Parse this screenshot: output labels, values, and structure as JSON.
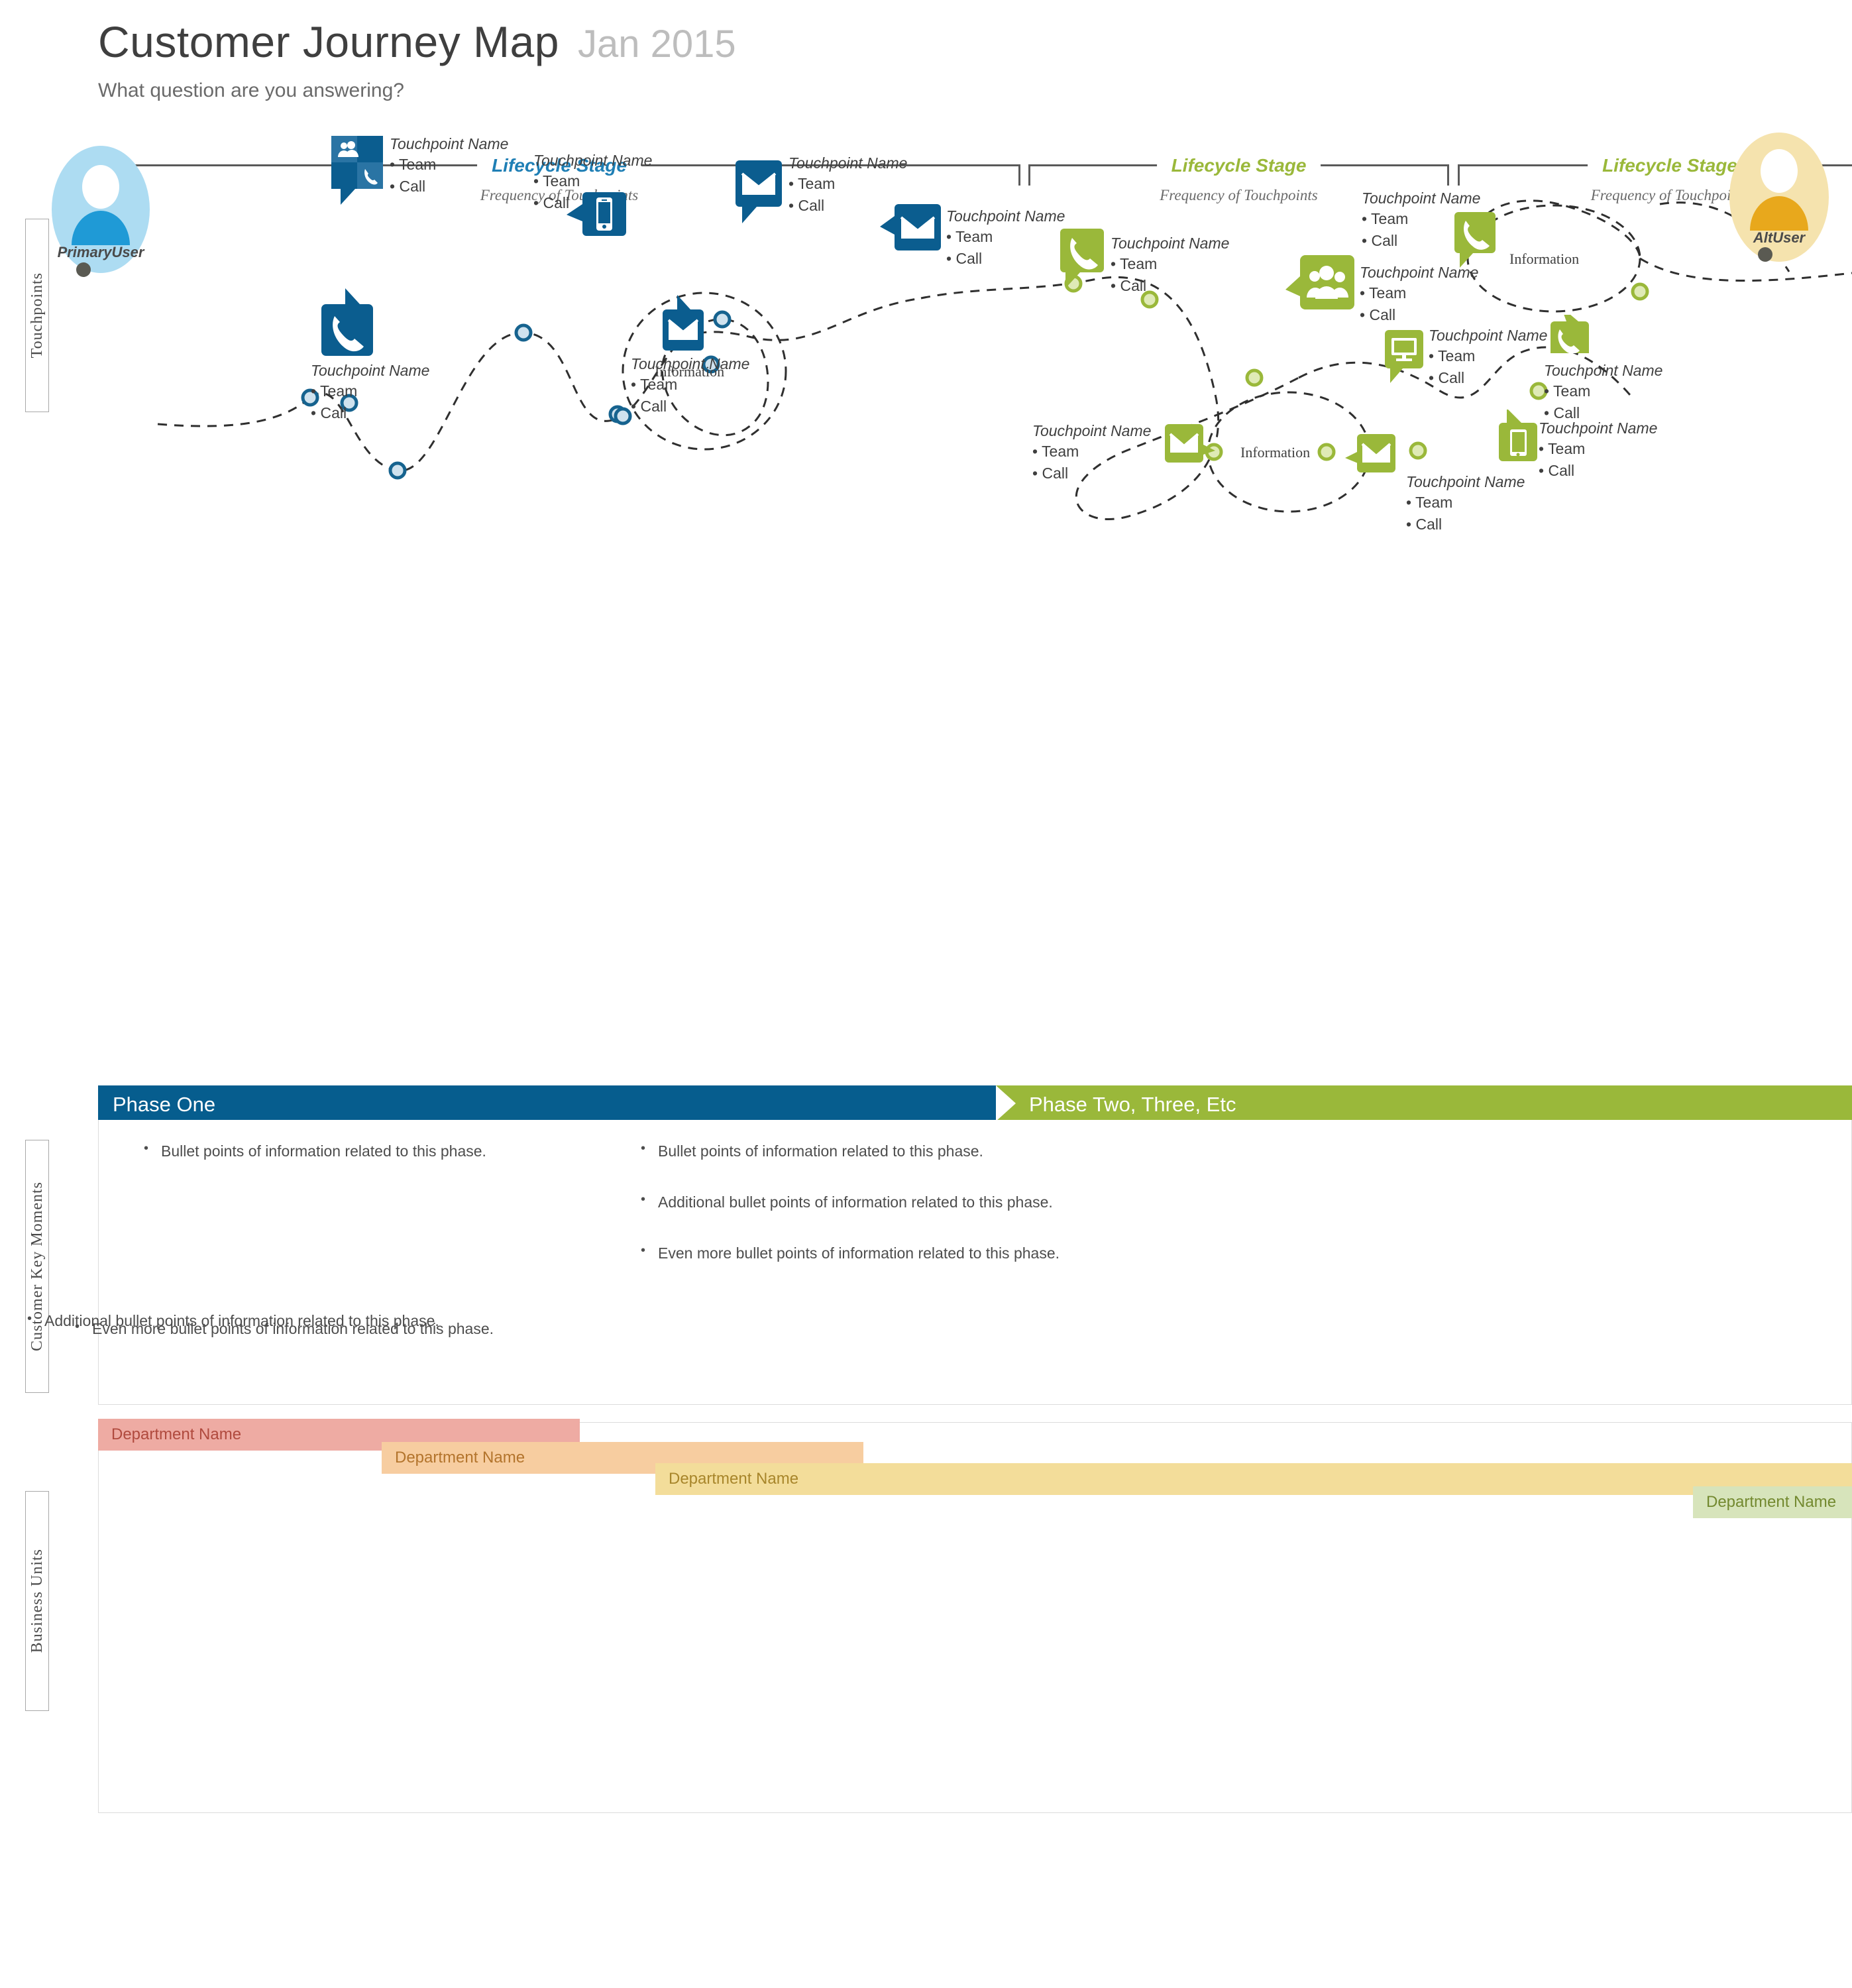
{
  "header": {
    "title": "Customer Journey Map",
    "date": "Jan 2015",
    "subtitle": "What question are you answering?"
  },
  "rails": {
    "touchpoints": "Touchpoints",
    "key_moments": "Customer Key Moments",
    "business_units": "Business Units"
  },
  "lifecycle_stages": [
    {
      "label": "Lifecycle Stage",
      "sublabel": "Frequency of Touchpoints",
      "color": "#1f7fb5"
    },
    {
      "label": "Lifecycle Stage",
      "sublabel": "Frequency of Touchpoints",
      "color": "#9ab83a"
    },
    {
      "label": "Lifecycle Stage",
      "sublabel": "Frequency of Touchpoints",
      "color": "#9ab83a"
    }
  ],
  "personas": [
    {
      "name": "PrimaryUser",
      "bubble_color": "#addcf2",
      "figure_color": "#1f9ad6"
    },
    {
      "name": "AltUser",
      "bubble_color": "#f5e3ae",
      "figure_color": "#e8a81c"
    }
  ],
  "touchpoints": [
    {
      "name": "Touchpoint Name",
      "items": [
        "Team",
        "Call"
      ],
      "icon": "team-call-icon",
      "color": "#0b5d8f"
    },
    {
      "name": "Touchpoint Name",
      "items": [
        "Team",
        "Call"
      ],
      "icon": "mobile-phone-icon",
      "color": "#0b5d8f"
    },
    {
      "name": "Touchpoint Name",
      "items": [
        "Team",
        "Call"
      ],
      "icon": "envelope-icon",
      "color": "#0b5d8f"
    },
    {
      "name": "Touchpoint Name",
      "items": [
        "Team",
        "Call"
      ],
      "icon": "envelope-icon",
      "color": "#0b5d8f"
    },
    {
      "name": "Touchpoint Name",
      "items": [
        "Team",
        "Call"
      ],
      "icon": "phone-icon",
      "color": "#0b5d8f"
    },
    {
      "name": "Touchpoint Name",
      "items": [
        "Team",
        "Call"
      ],
      "icon": "envelope-icon",
      "color": "#0b5d8f"
    },
    {
      "name": "Touchpoint Name",
      "items": [
        "Team",
        "Call"
      ],
      "icon": "phone-icon",
      "color": "#9ab83a"
    },
    {
      "name": "Touchpoint Name",
      "items": [
        "Team",
        "Call"
      ],
      "icon": "team-icon",
      "color": "#9ab83a"
    },
    {
      "name": "Touchpoint Name",
      "items": [
        "Team",
        "Call"
      ],
      "icon": "phone-icon",
      "color": "#9ab83a"
    },
    {
      "name": "Touchpoint Name",
      "items": [
        "Team",
        "Call"
      ],
      "icon": "monitor-icon",
      "color": "#9ab83a"
    },
    {
      "name": "Touchpoint Name",
      "items": [
        "Team",
        "Call"
      ],
      "icon": "phone-icon",
      "color": "#9ab83a"
    },
    {
      "name": "Touchpoint Name",
      "items": [
        "Team",
        "Call"
      ],
      "icon": "tablet-icon",
      "color": "#9ab83a"
    },
    {
      "name": "Touchpoint Name",
      "items": [
        "Team",
        "Call"
      ],
      "icon": "envelope-icon",
      "color": "#9ab83a"
    },
    {
      "name": "Touchpoint Name",
      "items": [
        "Team",
        "Call"
      ],
      "icon": "envelope-icon",
      "color": "#9ab83a"
    }
  ],
  "information_loops": [
    {
      "label": "Information"
    },
    {
      "label": "Information"
    },
    {
      "label": "Information"
    }
  ],
  "key_moments": {
    "phases": [
      {
        "label": "Phase One",
        "color": "#065d8e",
        "bullets": [
          "Bullet points of information related to this phase.",
          "Additional bullet points of information related to this phase.",
          "Even more bullet points of information related to this phase."
        ]
      },
      {
        "label": "Phase Two, Three, Etc",
        "color": "#9ab83a",
        "bullets": [
          "Bullet points of information related to this phase.",
          "Additional bullet points of information related to this phase.",
          "Even more bullet points of information related to this phase."
        ]
      }
    ]
  },
  "business_units": {
    "departments": [
      {
        "label": "Department Name",
        "color": "#eeaba3",
        "text_color": "#b04a3e"
      },
      {
        "label": "Department Name",
        "color": "#f7cda0",
        "text_color": "#b3742c"
      },
      {
        "label": "Department Name",
        "color": "#f3dd9a",
        "text_color": "#a8862b"
      },
      {
        "label": "Department Name",
        "color": "#d7e4bb",
        "text_color": "#73892f"
      }
    ]
  }
}
